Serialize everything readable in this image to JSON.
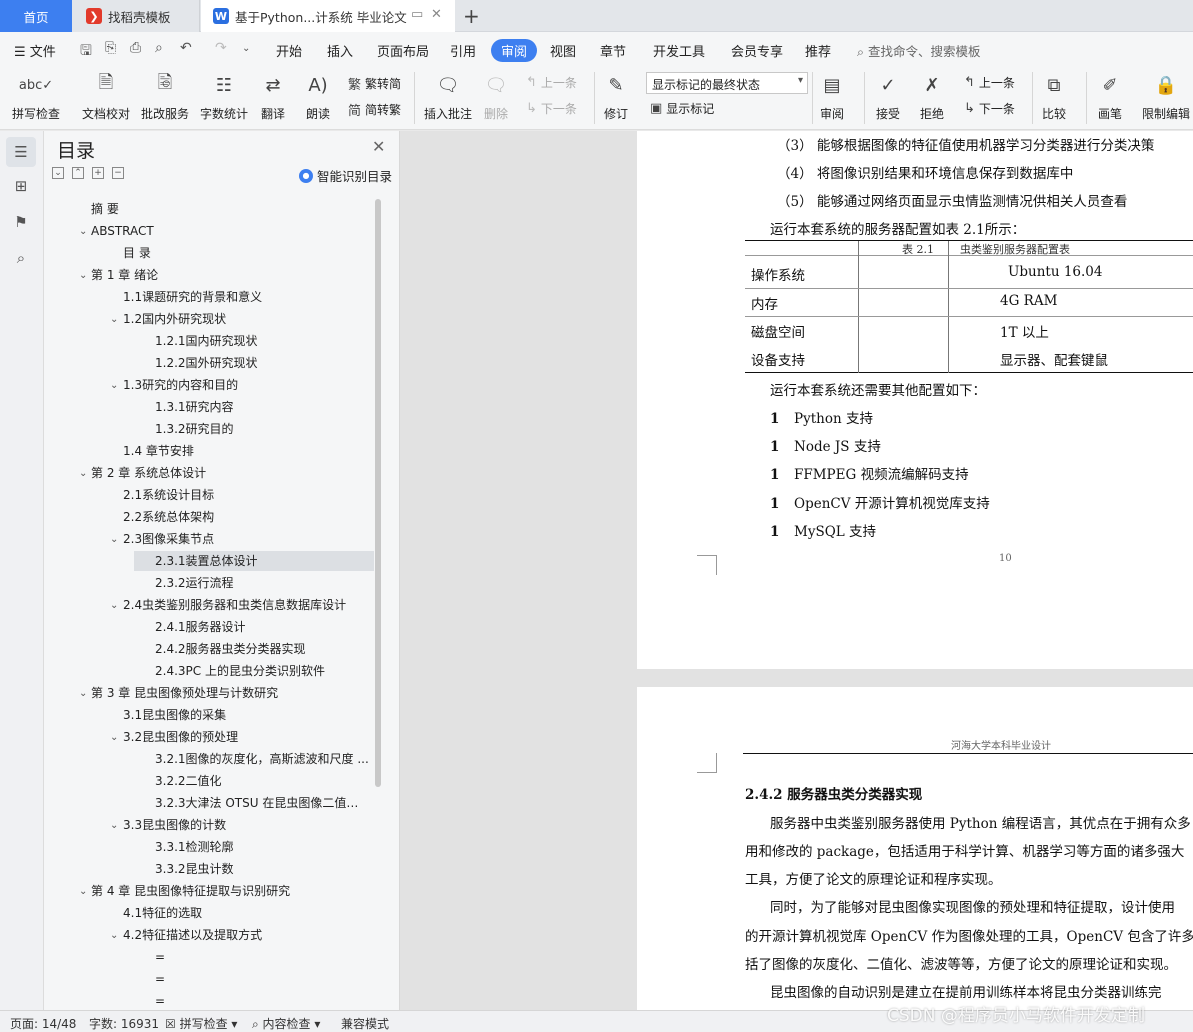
{
  "tabs": {
    "home": "首页",
    "docer": "找稻壳模板",
    "document": "基于Python...计系统 毕业论文",
    "add": "+"
  },
  "menu": {
    "file": "文件",
    "items": [
      "开始",
      "插入",
      "页面布局",
      "引用",
      "审阅",
      "视图",
      "章节",
      "开发工具",
      "会员专享",
      "推荐"
    ],
    "active": "审阅",
    "search": "查找命令、搜索模板"
  },
  "ribbon": {
    "spell_check": "拼写检查",
    "doc_proof": "文档校对",
    "batch_service": "批改服务",
    "word_count": "字数统计",
    "translate": "翻译",
    "read_aloud": "朗读",
    "trad_to_simp": "繁转简",
    "simp_to_trad": "简转繁",
    "insert_comment": "插入批注",
    "delete": "删除",
    "prev_comment": "上一条",
    "next_comment": "下一条",
    "revise": "修订",
    "markup_mode": "显示标记的最终状态",
    "show_markup": "显示标记",
    "review": "审阅",
    "accept": "接受",
    "reject": "拒绝",
    "prev_change": "上一条",
    "next_change": "下一条",
    "compare": "比较",
    "pen": "画笔",
    "restrict_edit": "限制编辑"
  },
  "nav": {
    "title": "目录",
    "smart_toc": "智能识别目录",
    "items": [
      {
        "text": "摘  要",
        "level": 0,
        "caret": ""
      },
      {
        "text": "ABSTRACT",
        "level": 0,
        "caret": "open"
      },
      {
        "text": "目  录",
        "level": 1,
        "caret": ""
      },
      {
        "text": "第 1 章  绪论",
        "level": 0,
        "caret": "open"
      },
      {
        "text": "1.1课题研究的背景和意义",
        "level": 1,
        "caret": ""
      },
      {
        "text": "1.2国内外研究现状",
        "level": 1,
        "caret": "open"
      },
      {
        "text": "1.2.1国内研究现状",
        "level": 2,
        "caret": ""
      },
      {
        "text": "1.2.2国外研究现状",
        "level": 2,
        "caret": ""
      },
      {
        "text": "1.3研究的内容和目的",
        "level": 1,
        "caret": "open"
      },
      {
        "text": "1.3.1研究内容",
        "level": 2,
        "caret": ""
      },
      {
        "text": "1.3.2研究目的",
        "level": 2,
        "caret": ""
      },
      {
        "text": "1.4 章节安排",
        "level": 1,
        "caret": ""
      },
      {
        "text": "第 2 章  系统总体设计",
        "level": 0,
        "caret": "open"
      },
      {
        "text": "2.1系统设计目标",
        "level": 1,
        "caret": ""
      },
      {
        "text": "2.2系统总体架构",
        "level": 1,
        "caret": ""
      },
      {
        "text": "2.3图像采集节点",
        "level": 1,
        "caret": "open"
      },
      {
        "text": "2.3.1装置总体设计",
        "level": 2,
        "caret": "",
        "selected": true
      },
      {
        "text": "2.3.2运行流程",
        "level": 2,
        "caret": ""
      },
      {
        "text": "2.4虫类鉴别服务器和虫类信息数据库设计",
        "level": 1,
        "caret": "open"
      },
      {
        "text": "2.4.1服务器设计",
        "level": 2,
        "caret": ""
      },
      {
        "text": "2.4.2服务器虫类分类器实现",
        "level": 2,
        "caret": ""
      },
      {
        "text": "2.4.3PC 上的昆虫分类识别软件",
        "level": 2,
        "caret": ""
      },
      {
        "text": "第 3 章  昆虫图像预处理与计数研究",
        "level": 0,
        "caret": "open"
      },
      {
        "text": "3.1昆虫图像的采集",
        "level": 1,
        "caret": ""
      },
      {
        "text": "3.2昆虫图像的预处理",
        "level": 1,
        "caret": "open"
      },
      {
        "text": "3.2.1图像的灰度化，高斯滤波和尺度 ...",
        "level": 2,
        "caret": ""
      },
      {
        "text": "3.2.2二值化",
        "level": 2,
        "caret": ""
      },
      {
        "text": "3.2.3大津法 OTSU 在昆虫图像二值化...",
        "level": 2,
        "caret": ""
      },
      {
        "text": "3.3昆虫图像的计数",
        "level": 1,
        "caret": "open"
      },
      {
        "text": "3.3.1检测轮廓",
        "level": 2,
        "caret": ""
      },
      {
        "text": "3.3.2昆虫计数",
        "level": 2,
        "caret": ""
      },
      {
        "text": "第 4 章  昆虫图像特征提取与识别研究",
        "level": 0,
        "caret": "open"
      },
      {
        "text": "4.1特征的选取",
        "level": 1,
        "caret": ""
      },
      {
        "text": "4.2特征描述以及提取方式",
        "level": 1,
        "caret": "open"
      },
      {
        "text": "=",
        "level": 2,
        "caret": ""
      },
      {
        "text": "=",
        "level": 2,
        "caret": ""
      },
      {
        "text": "=",
        "level": 2,
        "caret": ""
      }
    ]
  },
  "doc": {
    "page1": {
      "list_items": [
        "（3）  能够根据图像的特征值使用机器学习分类器进行分类决策",
        "（4）  将图像识别结果和环境信息保存到数据库中",
        "（5）  能够通过网络页面显示虫情监测情况供相关人员查看"
      ],
      "config_intro": "运行本套系统的服务器配置如表 2.1所示：",
      "table_caption_num": "表 2.1",
      "table_caption": "虫类鉴别服务器配置表",
      "table_rows": [
        {
          "label": "操作系统",
          "value": "Ubuntu 16.04"
        },
        {
          "label": "内存",
          "value": "4G RAM"
        },
        {
          "label": "磁盘空间",
          "value": "1T 以上"
        },
        {
          "label": "设备支持",
          "value": "显示器、配套键鼠"
        }
      ],
      "other_config_intro": "运行本套系统还需要其他配置如下：",
      "bullets": [
        "Python 支持",
        "Node JS 支持",
        "FFMPEG 视频流编解码支持",
        "OpenCV 开源计算机视觉库支持",
        "MySQL 支持"
      ],
      "bullet_marker": "1",
      "page_number": "10"
    },
    "page2": {
      "header": "河海大学本科毕业设计",
      "heading": "2.4.2 服务器虫类分类器实现",
      "paragraphs": [
        "服务器中虫类鉴别服务器使用 Python 编程语言，其优点在于拥有众多",
        "用和修改的 package，包括适用于科学计算、机器学习等方面的诸多强大",
        "工具，方便了论文的原理论证和程序实现。",
        "同时，为了能够对昆虫图像实现图像的预处理和特征提取，设计使用",
        "的开源计算机视觉库 OpenCV 作为图像处理的工具，OpenCV 包含了许多材",
        "括了图像的灰度化、二值化、滤波等等，方便了论文的原理论证和实现。",
        "昆虫图像的自动识别是建立在提前用训练样本将昆虫分类器训练完"
      ]
    }
  },
  "status": {
    "page": "页面: 14/48",
    "words": "字数: 16931",
    "spell": "拼写检查",
    "content_check": "内容检查",
    "compat": "兼容模式"
  },
  "watermark": "CSDN @程序员小马软件开发定制"
}
